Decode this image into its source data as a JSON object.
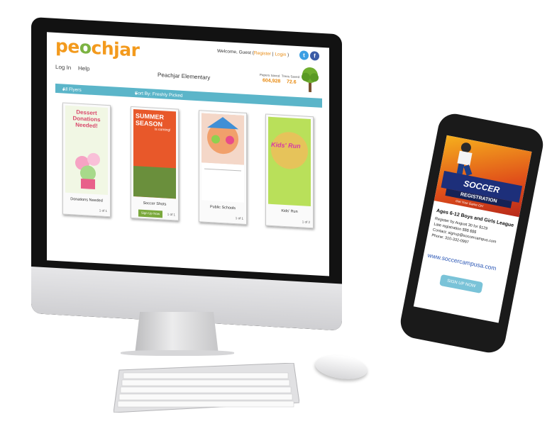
{
  "desktop": {
    "logo": {
      "pre": "pe",
      "leaf": "o",
      "post": "chjar"
    },
    "welcome": {
      "text": "Welcome, Guest (",
      "register": "Register",
      "sep": " | ",
      "login": "Login",
      "close": " )"
    },
    "nav": {
      "login": "Log In",
      "help": "Help"
    },
    "school": "Peachjar Elementary",
    "stats": {
      "papers_label": "Papers Saved",
      "trees_label": "Trees Saved",
      "papers_value": "604,928",
      "trees_value": "72.6"
    },
    "filters": {
      "all_flyers": "All Flyers",
      "sort": "Sort By: Freshly Picked"
    },
    "flyers": [
      {
        "title": "Donations Needed",
        "count": "1 of 1",
        "headline": "Dessert Donations Needed!"
      },
      {
        "title": "Soccer Shots",
        "count": "1 of 1",
        "button": "Sign Up Now",
        "headline": "SUMMER SEASON",
        "subhead": "is coming!"
      },
      {
        "title": "Public Schools",
        "count": "1 of 1"
      },
      {
        "title": "Kids' Run",
        "count": "1 of 2",
        "headline": "Kids' Run"
      }
    ]
  },
  "phone": {
    "ad_title": "SOCCER",
    "ad_subtitle": "REGISTRATION",
    "ad_tagline": "Get Your Game On!",
    "headline": "Ages 6-12 Boys and Girls League",
    "lines": [
      "Register by August 30 for $129",
      "Late registration $$$ $$$",
      "Contact: signup@soccercampus.com",
      "Phone: 310-332-0997"
    ],
    "url": "www.soccercampusa.com",
    "button": "SIGN UP NOW"
  },
  "colors": {
    "brand_orange": "#f39a1d",
    "bar_blue": "#5bb5c9",
    "signup_green": "#7aa83c"
  },
  "icons": [
    "twitter-icon",
    "facebook-icon",
    "tree-icon",
    "chevron-down-icon"
  ]
}
